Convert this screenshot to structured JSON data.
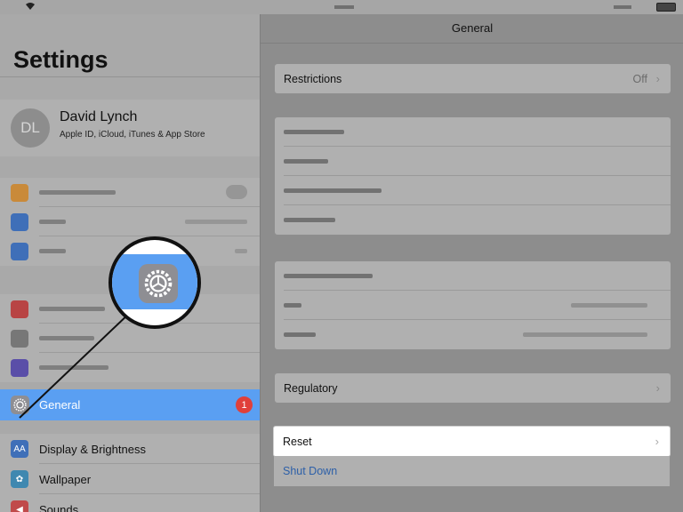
{
  "status_bar": {
    "wifi_icon": "wifi-icon",
    "battery_icon": "battery-icon"
  },
  "sidebar": {
    "title": "Settings",
    "profile": {
      "initials": "DL",
      "name": "David Lynch",
      "subtitle": "Apple ID, iCloud, iTunes & App Store"
    },
    "selected_item": {
      "label": "General",
      "badge": "1",
      "icon": "gear-icon"
    },
    "items": [
      {
        "label": "Display & Brightness",
        "icon": "text-size-icon",
        "color": "#3f6fb8"
      },
      {
        "label": "Wallpaper",
        "icon": "flower-icon",
        "color": "#3f88b0"
      },
      {
        "label": "Sounds",
        "icon": "speaker-icon",
        "color": "#c04a4a"
      }
    ]
  },
  "detail": {
    "title": "General",
    "restrictions": {
      "label": "Restrictions",
      "value": "Off"
    },
    "regulatory": {
      "label": "Regulatory"
    },
    "reset": {
      "label": "Reset"
    },
    "shut_down": {
      "label": "Shut Down"
    }
  },
  "colors": {
    "selection_blue": "#5a9ff2",
    "badge_red": "#e0403a",
    "link_blue": "#2c5fa8"
  }
}
